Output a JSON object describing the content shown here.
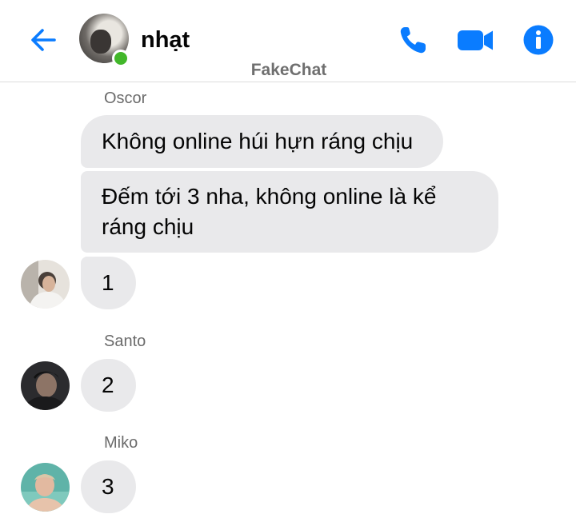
{
  "header": {
    "contact_name": "nhạt",
    "watermark": "FakeChat",
    "icons": [
      "back-arrow-icon",
      "phone-icon",
      "video-camera-icon",
      "info-icon"
    ],
    "accent_color": "#0a7cff",
    "online_color": "#42b72a"
  },
  "messages": {
    "group1": {
      "sender": "Oscor",
      "bubble1": "Không online húi hựn ráng chịu",
      "bubble2_line1": "Đếm tới 3 nha, không online là kể",
      "bubble2_line2": "ráng chịu",
      "bubble3": "1"
    },
    "group2": {
      "sender": "Santo",
      "bubble": "2"
    },
    "group3": {
      "sender": "Miko",
      "bubble": "3"
    }
  },
  "colors": {
    "bubble_bg": "#e9e9eb",
    "sender_text": "#6b6b6b"
  }
}
